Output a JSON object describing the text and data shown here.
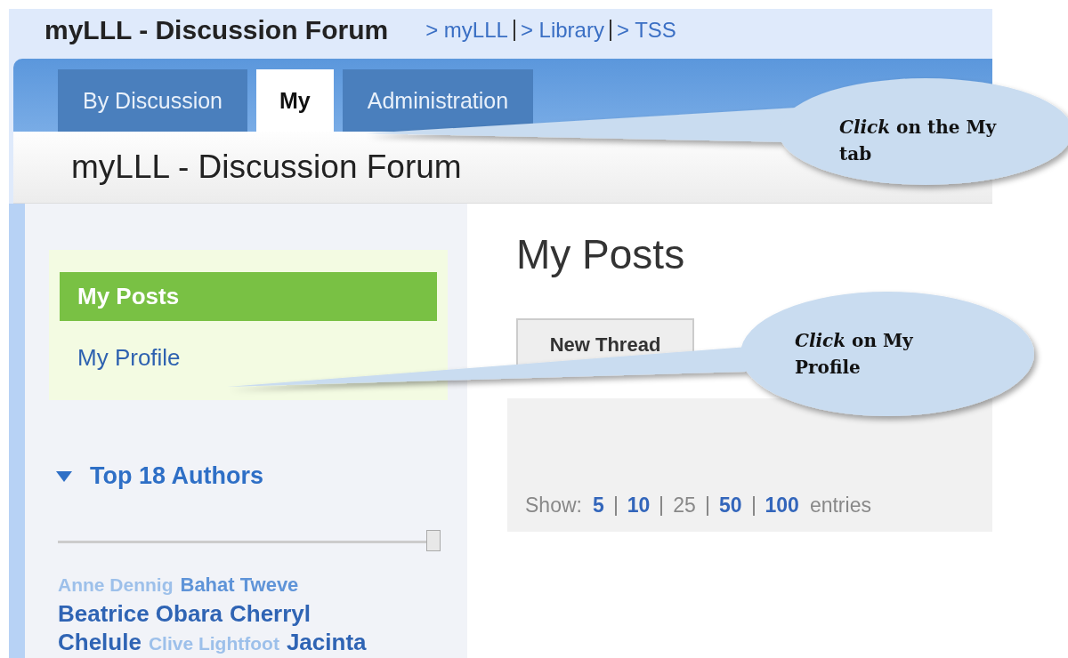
{
  "header": {
    "title": "myLLL - Discussion Forum",
    "breadcrumbs": [
      "> myLLL",
      "> Library",
      "> TSS"
    ]
  },
  "tabs": [
    {
      "label": "By Discussion",
      "selected": false
    },
    {
      "label": "My",
      "selected": true
    },
    {
      "label": "Administration",
      "selected": false
    }
  ],
  "page_title": "myLLL - Discussion Forum",
  "sidebar": {
    "items": [
      {
        "label": "My Posts",
        "selected": true
      },
      {
        "label": "My Profile",
        "selected": false
      }
    ],
    "authors": {
      "heading": "Top 18 Authors",
      "expanded": true,
      "slider": {
        "level": 1
      },
      "lines": [
        [
          {
            "name": "Anne Dennig",
            "kind": "minor"
          },
          {
            "name": "Bahat Tweve",
            "kind": "mid"
          }
        ],
        [
          {
            "name": "Beatrice Obara",
            "kind": "major"
          },
          {
            "name": "Cherryl",
            "kind": "major"
          }
        ],
        [
          {
            "name": "Chelule",
            "kind": "major"
          },
          {
            "name": "Clive Lightfoot",
            "kind": "minor"
          },
          {
            "name": "Jacinta",
            "kind": "major"
          }
        ]
      ]
    }
  },
  "main": {
    "heading": "My Posts",
    "button": "New Thread",
    "show_label": "Show:",
    "page_sizes": [
      {
        "label": "5",
        "selected": false
      },
      {
        "label": "10",
        "selected": false
      },
      {
        "label": "25",
        "selected": true
      },
      {
        "label": "50",
        "selected": false
      },
      {
        "label": "100",
        "selected": false
      }
    ],
    "entries_label": "entries"
  },
  "callouts": [
    {
      "text": "*Click* on the My tab"
    },
    {
      "text": "*Click* on My Profile"
    }
  ]
}
